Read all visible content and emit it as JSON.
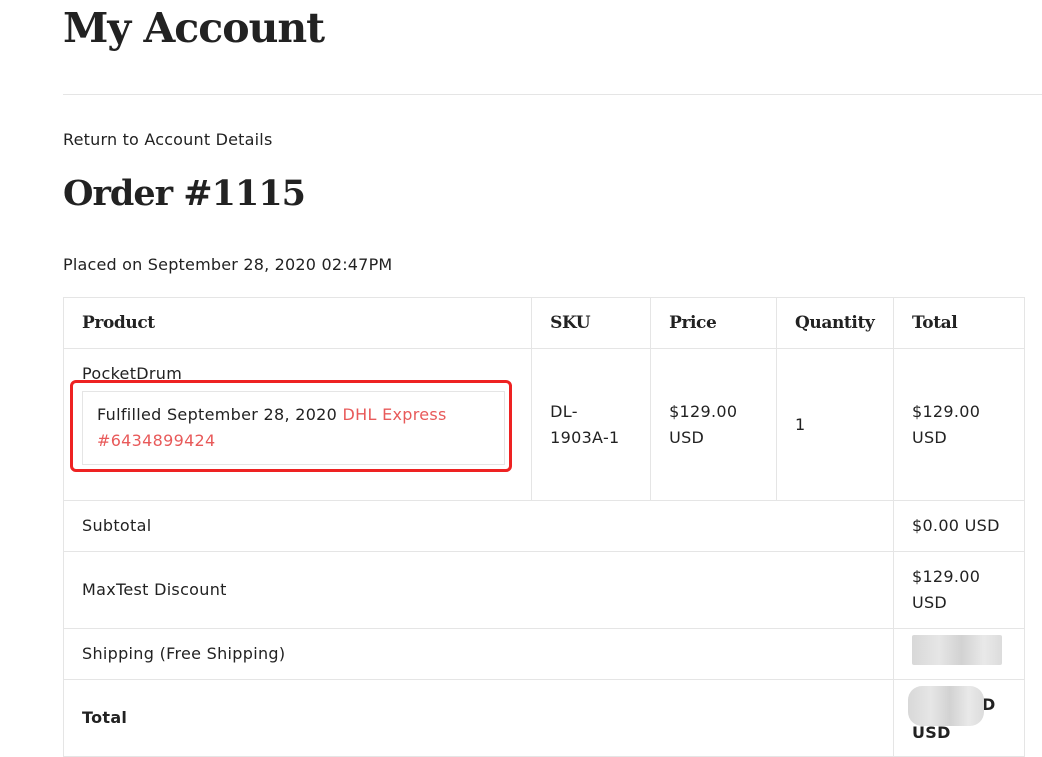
{
  "page": {
    "title": "My Account"
  },
  "nav": {
    "return_link": "Return to Account Details"
  },
  "order": {
    "title": "Order #1115",
    "placed": "Placed on September 28, 2020 02:47PM"
  },
  "table": {
    "headers": {
      "product": "Product",
      "sku": "SKU",
      "price": "Price",
      "quantity": "Quantity",
      "total": "Total"
    },
    "item": {
      "product": "PocketDrum",
      "fulfilled_text": "Fulfilled September 28, 2020",
      "tracking_carrier": "DHL Express",
      "tracking_number": "#6434899424",
      "sku_line1": "DL-",
      "sku_line2": "1903A-1",
      "price_amount": "$129.00",
      "price_currency": "USD",
      "quantity": "1",
      "total_amount": "$129.00",
      "total_currency": "USD"
    },
    "subtotal": {
      "label": "Subtotal",
      "value": "$0.00 USD"
    },
    "discount": {
      "label": "MaxTest Discount",
      "value_amount": "$129.00",
      "value_currency": "USD"
    },
    "shipping": {
      "label": "Shipping (Free Shipping)"
    },
    "total": {
      "label": "Total",
      "visible_suffix": "D",
      "visible_currency": "USD"
    }
  },
  "colors": {
    "tracking_link": "#e85a5a",
    "highlight_box": "#ee2222",
    "border": "#e5e5e5"
  }
}
